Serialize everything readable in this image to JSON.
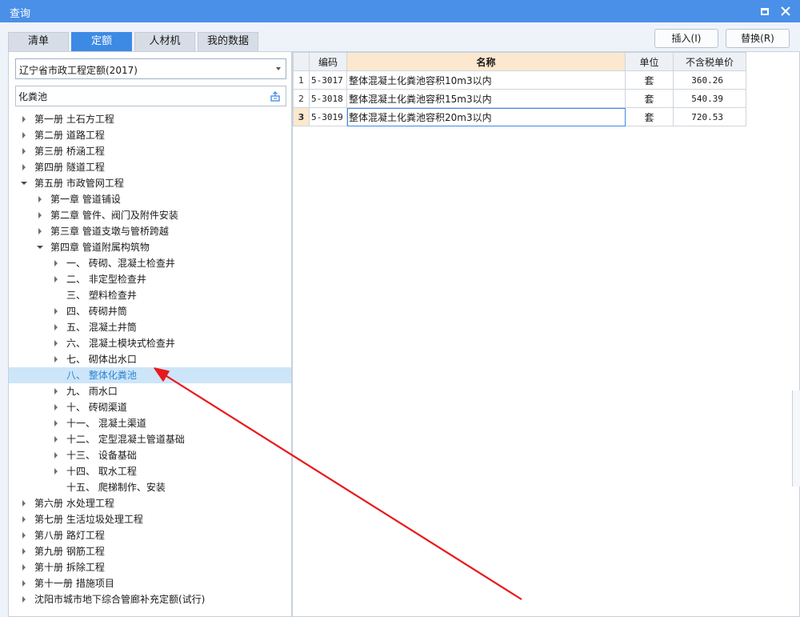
{
  "window": {
    "title": "查询"
  },
  "tabs": [
    {
      "label": "清单",
      "active": false
    },
    {
      "label": "定额",
      "active": true
    },
    {
      "label": "人材机",
      "active": false
    },
    {
      "label": "我的数据",
      "active": false
    }
  ],
  "buttons": {
    "insert": "插入(I)",
    "replace": "替换(R)"
  },
  "library": {
    "selected": "辽宁省市政工程定额(2017)"
  },
  "search": {
    "value": "化粪池",
    "placeholder": ""
  },
  "tree": [
    {
      "label": "第一册 土石方工程",
      "level": 0,
      "toggle": "closed"
    },
    {
      "label": "第二册 道路工程",
      "level": 0,
      "toggle": "closed"
    },
    {
      "label": "第三册 桥涵工程",
      "level": 0,
      "toggle": "closed"
    },
    {
      "label": "第四册 隧道工程",
      "level": 0,
      "toggle": "closed"
    },
    {
      "label": "第五册 市政管网工程",
      "level": 0,
      "toggle": "open"
    },
    {
      "label": "第一章 管道铺设",
      "level": 1,
      "toggle": "closed"
    },
    {
      "label": "第二章 管件、阀门及附件安装",
      "level": 1,
      "toggle": "closed"
    },
    {
      "label": "第三章 管道支墩与管桥跨越",
      "level": 1,
      "toggle": "closed"
    },
    {
      "label": "第四章 管道附属构筑物",
      "level": 1,
      "toggle": "open"
    },
    {
      "label": "一、 砖砌、混凝土检查井",
      "level": 2,
      "toggle": "closed"
    },
    {
      "label": "二、 非定型检查井",
      "level": 2,
      "toggle": "closed"
    },
    {
      "label": "三、 塑料检查井",
      "level": 2,
      "toggle": "none"
    },
    {
      "label": "四、 砖砌井筒",
      "level": 2,
      "toggle": "closed"
    },
    {
      "label": "五、 混凝土井筒",
      "level": 2,
      "toggle": "closed"
    },
    {
      "label": "六、 混凝土模块式检查井",
      "level": 2,
      "toggle": "closed"
    },
    {
      "label": "七、 砌体出水口",
      "level": 2,
      "toggle": "closed"
    },
    {
      "label": "八、 整体化粪池",
      "level": 2,
      "toggle": "none",
      "selected": true
    },
    {
      "label": "九、 雨水口",
      "level": 2,
      "toggle": "closed"
    },
    {
      "label": "十、 砖砌渠道",
      "level": 2,
      "toggle": "closed"
    },
    {
      "label": "十一、 混凝土渠道",
      "level": 2,
      "toggle": "closed"
    },
    {
      "label": "十二、 定型混凝土管道基础",
      "level": 2,
      "toggle": "closed"
    },
    {
      "label": "十三、 设备基础",
      "level": 2,
      "toggle": "closed"
    },
    {
      "label": "十四、 取水工程",
      "level": 2,
      "toggle": "closed"
    },
    {
      "label": "十五、 爬梯制作、安装",
      "level": 2,
      "toggle": "none"
    },
    {
      "label": "第六册 水处理工程",
      "level": 0,
      "toggle": "closed"
    },
    {
      "label": "第七册 生活垃圾处理工程",
      "level": 0,
      "toggle": "closed"
    },
    {
      "label": "第八册 路灯工程",
      "level": 0,
      "toggle": "closed"
    },
    {
      "label": "第九册 钢筋工程",
      "level": 0,
      "toggle": "closed"
    },
    {
      "label": "第十册 拆除工程",
      "level": 0,
      "toggle": "closed"
    },
    {
      "label": "第十一册 措施项目",
      "level": 0,
      "toggle": "closed"
    },
    {
      "label": "沈阳市城市地下综合管廊补充定额(试行)",
      "level": 0,
      "toggle": "closed"
    }
  ],
  "grid": {
    "headers": {
      "code": "编码",
      "name": "名称",
      "unit": "单位",
      "price": "不含税单价"
    },
    "rows": [
      {
        "rn": "1",
        "code": "5-3017",
        "name": "整体混凝土化粪池容积10m3以内",
        "unit": "套",
        "price": "360.26",
        "current": false
      },
      {
        "rn": "2",
        "code": "5-3018",
        "name": "整体混凝土化粪池容积15m3以内",
        "unit": "套",
        "price": "540.39",
        "current": false
      },
      {
        "rn": "3",
        "code": "5-3019",
        "name": "整体混凝土化粪池容积20m3以内",
        "unit": "套",
        "price": "720.53",
        "current": true
      }
    ]
  },
  "icons": {
    "close": "close-icon",
    "maximize": "maximize-icon",
    "dropdown": "chevron-down-icon",
    "search": "search-icon",
    "expand": "triangle-right-icon",
    "collapse": "triangle-down-icon",
    "annotation": "arrow-annotation"
  },
  "colors": {
    "titlebar": "#4a8fe8",
    "active_tab": "#3d8ae5",
    "selected_row": "#cde5f8",
    "header_highlight": "#fbe8cf",
    "annotation_arrow": "#e8191c"
  }
}
